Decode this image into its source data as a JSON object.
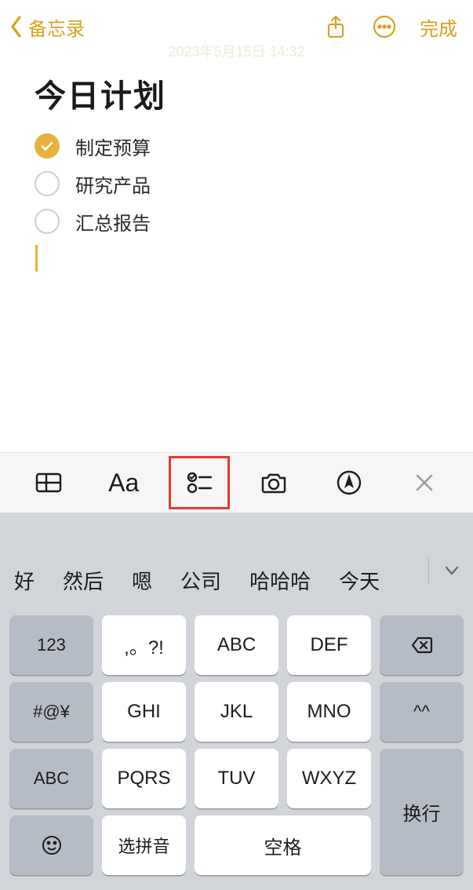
{
  "nav": {
    "back_label": "备忘录",
    "done_label": "完成"
  },
  "timestamp": "2023年5月15日 14:32",
  "note": {
    "title": "今日计划",
    "items": [
      {
        "text": "制定预算",
        "checked": true
      },
      {
        "text": "研究产品",
        "checked": false
      },
      {
        "text": "汇总报告",
        "checked": false
      }
    ]
  },
  "format_bar": {
    "aa_label": "Aa"
  },
  "keyboard": {
    "candidates": [
      "好",
      "然后",
      "嗯",
      "公司",
      "哈哈哈",
      "今天"
    ],
    "keys": {
      "num": "123",
      "punct": ",。?!",
      "abc": "ABC",
      "def": "DEF",
      "sym": "#@¥",
      "ghi": "GHI",
      "jkl": "JKL",
      "mno": "MNO",
      "face": "^^",
      "abc2": "ABC",
      "pqrs": "PQRS",
      "tuv": "TUV",
      "wxyz": "WXYZ",
      "select": "选拼音",
      "space": "空格",
      "return": "换行"
    }
  }
}
